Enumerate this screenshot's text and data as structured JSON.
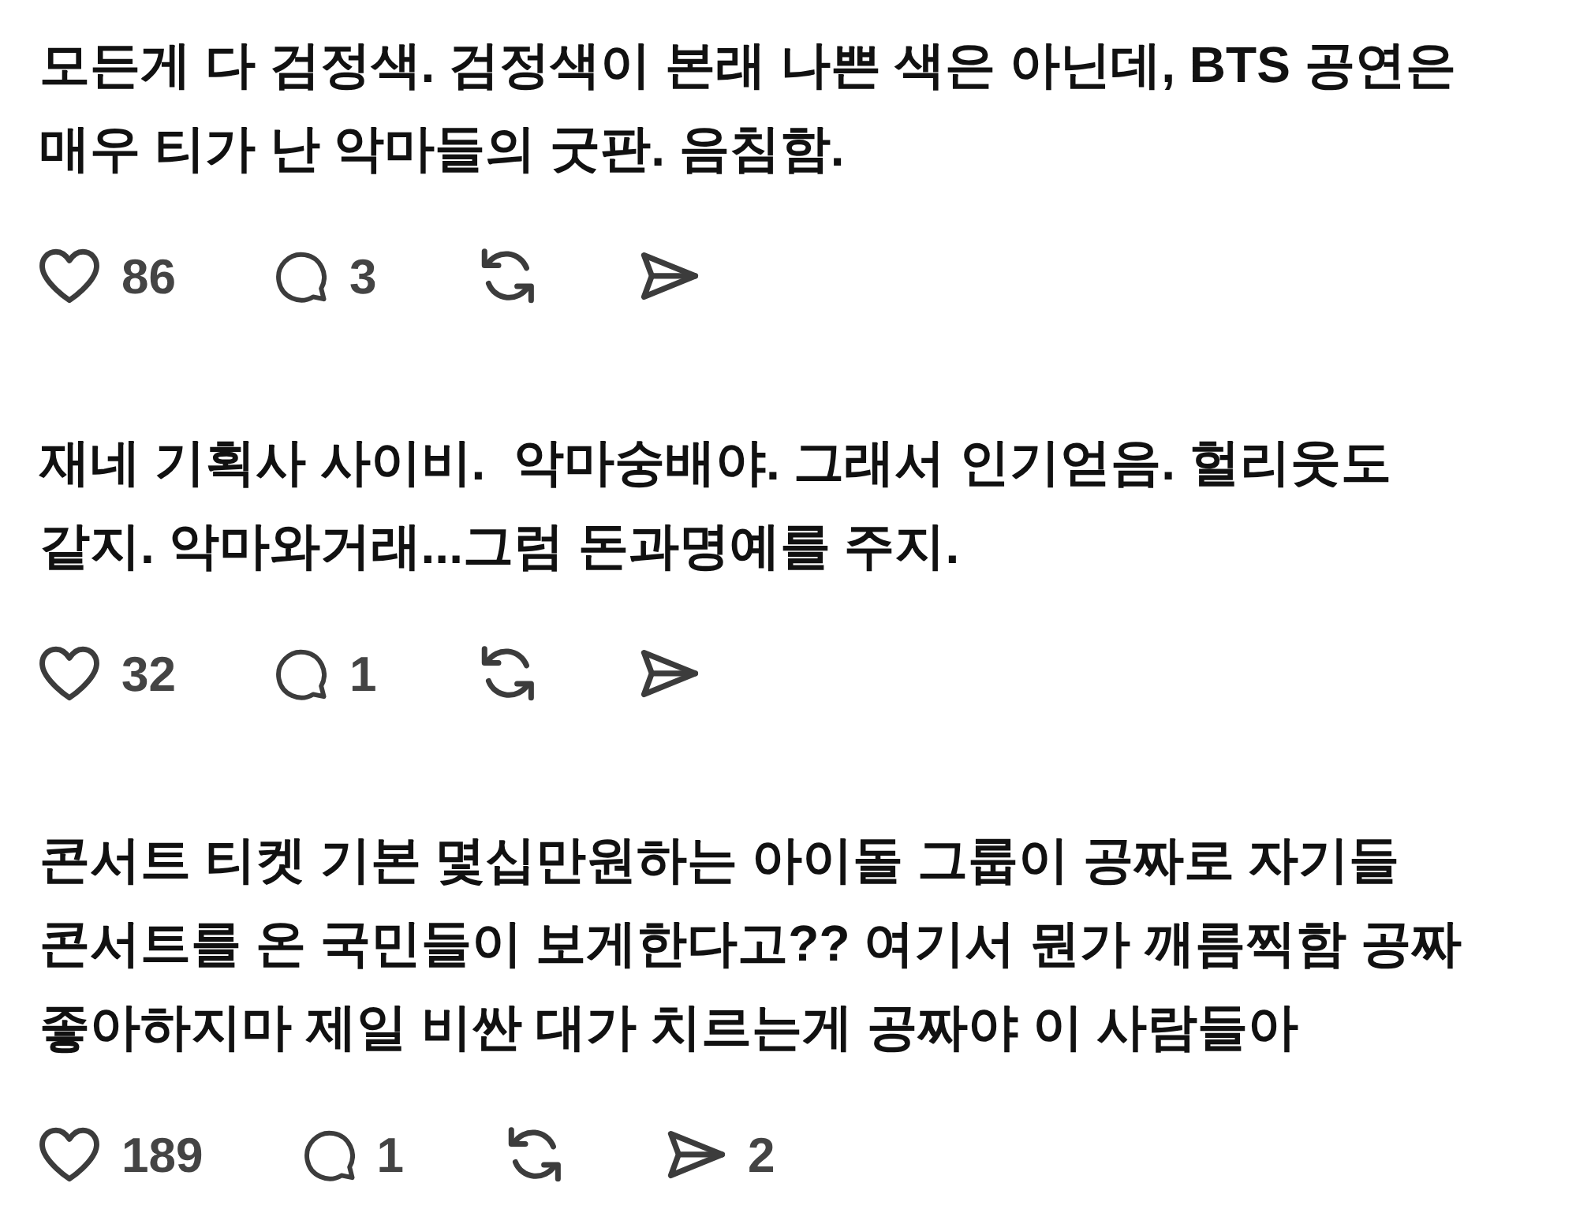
{
  "posts": [
    {
      "text_lines": [
        "모든게 다 검정색. 검정색이 본래 나쁜 색은 아닌데, BTS 공연은",
        "매우 티가 난 악마들의 굿판. 음침함."
      ],
      "likes": "86",
      "replies": "3"
    },
    {
      "text_lines": [
        "재네 기획사 사이비.  악마숭배야. 그래서 인기얻음. 헐리웃도",
        "같지. 악마와거래...그럼 돈과명예를 주지."
      ],
      "likes": "32",
      "replies": "1"
    },
    {
      "text_lines": [
        "콘서트 티켓 기본 몇십만원하는 아이돌 그룹이 공짜로 자기들",
        "콘서트를 온 국민들이 보게한다고?? 여기서 뭔가 깨름찍함 공짜",
        "좋아하지마 제일 비싼 대가 치르는게 공짜야 이 사람들아"
      ],
      "likes": "189",
      "replies": "1",
      "shares": "2"
    }
  ]
}
